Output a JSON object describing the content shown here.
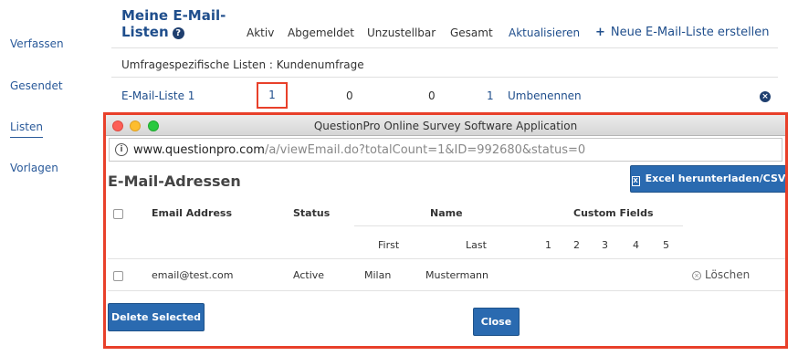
{
  "sidebar": {
    "items": [
      {
        "label": "Verfassen"
      },
      {
        "label": "Gesendet"
      },
      {
        "label": "Listen"
      },
      {
        "label": "Vorlagen"
      }
    ]
  },
  "header": {
    "title": "Meine E-Mail-Listen",
    "help_icon": "?",
    "columns": [
      "Aktiv",
      "Abgemeldet",
      "Unzustellbar",
      "Gesamt",
      "Aktualisieren"
    ],
    "new_list_label": "Neue E-Mail-Liste erstellen"
  },
  "section": {
    "label": "Umfragespezifische Listen : Kundenumfrage"
  },
  "list_row": {
    "name": "E-Mail-Liste 1",
    "aktiv": "1",
    "abgemeldet": "0",
    "unzustellbar": "0",
    "gesamt": "1",
    "rename": "Umbenennen"
  },
  "popup": {
    "window_title": "QuestionPro Online Survey Software Application",
    "url_domain": "www.questionpro.com",
    "url_path": "/a/viewEmail.do?totalCount=1&ID=992680&status=0",
    "heading": "E-Mail-Adressen",
    "excel_button": "Excel herunterladen/CSV",
    "table": {
      "headers": {
        "email": "Email Address",
        "status": "Status",
        "name": "Name",
        "custom": "Custom Fields"
      },
      "subheaders": {
        "first": "First",
        "last": "Last",
        "custom": [
          "1",
          "2",
          "3",
          "4",
          "5"
        ]
      },
      "rows": [
        {
          "email": "email@test.com",
          "status": "Active",
          "first": "Milan",
          "last": "Mustermann",
          "action": "Löschen"
        }
      ]
    },
    "delete_selected": "Delete Selected",
    "close": "Close"
  }
}
